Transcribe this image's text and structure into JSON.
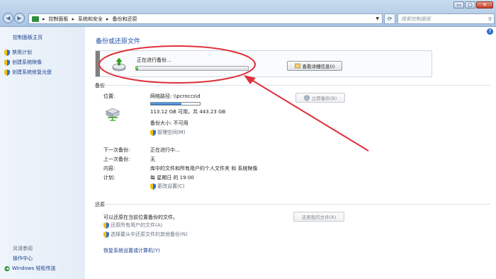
{
  "window": {
    "minimize": "▭",
    "maximize": "▢",
    "close": "✕"
  },
  "addressbar": {
    "crumbs": [
      "控制面板",
      "系统和安全",
      "备份和还原"
    ],
    "search_placeholder": "搜索控制面板"
  },
  "sidebar": {
    "home": "控制面板主页",
    "tasks": [
      "禁用计划",
      "创建系统映像",
      "创建系统修复光盘"
    ],
    "see_also_title": "另请参阅",
    "see_also": [
      "操作中心",
      "Windows 轻松传送"
    ]
  },
  "main": {
    "title": "备份或还原文件",
    "progress": {
      "label": "正在进行备份...",
      "fraction": 0.02,
      "details_button": "查看详细信息(I)"
    },
    "backup": {
      "section": "备份",
      "location_label": "位置:",
      "location_value": "网络路径: \\\\pcroccs\\d",
      "usage_fraction": 0.62,
      "space_text": "113.12 GB 可用，共 443.23 GB",
      "size_text": "备份大小: 不可用",
      "manage_space": "管理空间(M)",
      "backup_now": "立即备份(B)",
      "next_label": "下一次备份:",
      "next_value": "正在进行中...",
      "last_label": "上一次备份:",
      "last_value": "无",
      "content_label": "内容:",
      "content_value": "库中的文件和所有用户的个人文件夹 和 系统映像",
      "schedule_label": "计划:",
      "schedule_value": "每 星期日 的 19:00",
      "change_settings": "更改设置(C)"
    },
    "restore": {
      "section": "还原",
      "desc": "可以还原在当前位置备份的文件。",
      "restore_all": "还原所有用户的文件(A)",
      "select_other": "选择要从中还原文件的其他备份(N)",
      "restore_my_files": "还原我的文件(R)",
      "recover_system": "恢复系统设置或计算机(Y)"
    }
  },
  "colors": {
    "link": "#1a3f8c",
    "title": "#1f4ea8",
    "annotation": "#e0303a",
    "progress": "#2ea51a"
  }
}
